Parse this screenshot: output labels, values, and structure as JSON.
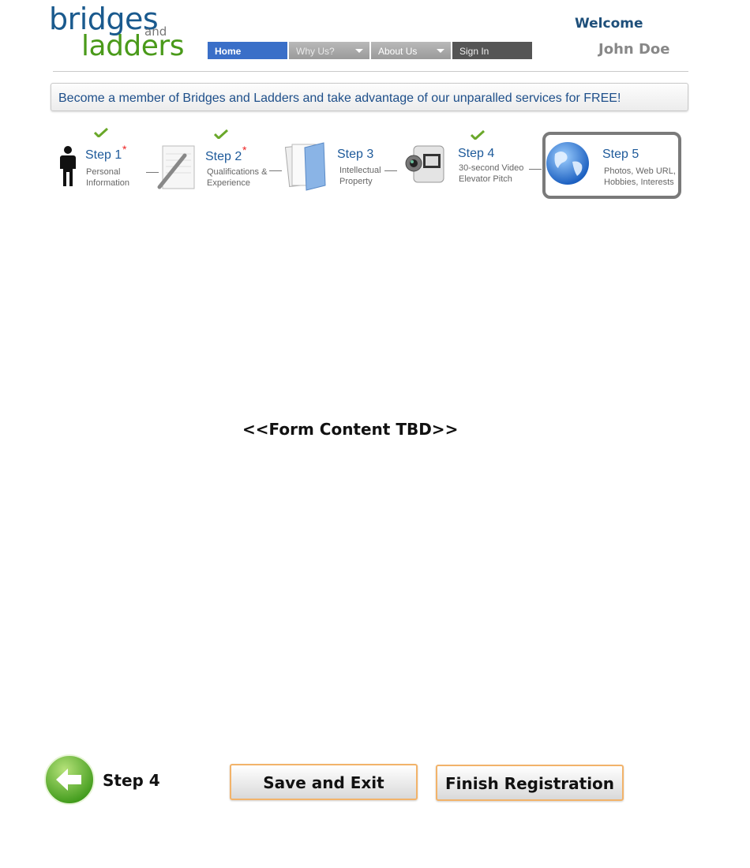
{
  "logo": {
    "word1": "bridges",
    "word2": "and",
    "word3": "ladders"
  },
  "nav": {
    "home": "Home",
    "why": "Why Us?",
    "about": "About Us",
    "signin": "Sign In"
  },
  "user": {
    "welcome": "Welcome",
    "name": "John Doe"
  },
  "banner": "Become a member of Bridges and Ladders and take advantage of our unparalled services for FREE!",
  "steps": [
    {
      "title": "Step 1",
      "desc1": "Personal",
      "desc2": "Information",
      "required": "*",
      "icon": "person-icon",
      "completed": true
    },
    {
      "title": "Step 2",
      "desc1": "Qualifications &",
      "desc2": "Experience",
      "required": "*",
      "icon": "notepad-pencil-icon",
      "completed": true
    },
    {
      "title": "Step 3",
      "desc1": "Intellectual",
      "desc2": "Property",
      "icon": "folder-documents-icon",
      "completed": false
    },
    {
      "title": "Step 4",
      "desc1": "30-second Video",
      "desc2": "Elevator Pitch",
      "icon": "video-camera-icon",
      "completed": true
    },
    {
      "title": "Step 5",
      "desc1": "Photos, Web URL,",
      "desc2": "Hobbies, Interests",
      "icon": "globe-icon",
      "completed": false,
      "current": true
    }
  ],
  "form_placeholder": "<<Form Content TBD>>",
  "footer": {
    "back_label": "Step 4",
    "save_label": "Save and Exit",
    "finish_label": "Finish Registration"
  },
  "colors": {
    "brand_blue": "#1a5a8e",
    "brand_green": "#4a9a1a",
    "nav_active": "#3a6fc8",
    "button_border": "#f2b36a",
    "check_green": "#6aa82a"
  }
}
